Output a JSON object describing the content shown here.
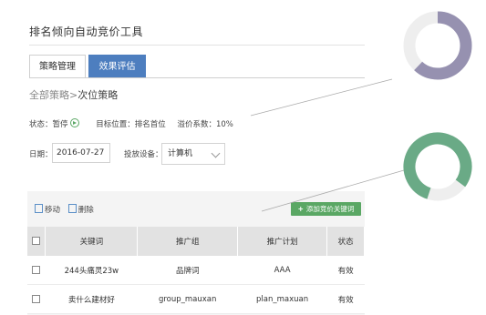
{
  "app": {
    "title": "排名倾向自动竞价工具"
  },
  "tabs": [
    {
      "label": "策略管理",
      "active": true
    },
    {
      "label": "效果评估",
      "active": false
    }
  ],
  "breadcrumb": {
    "root": "全部策略",
    "sep": ">",
    "current": "次位策略"
  },
  "status": {
    "label": "状态：暂停",
    "target": "目标位置：排名首位",
    "premium": "溢价系数：10%"
  },
  "filters": {
    "date_label": "日期：",
    "date_value": "2016-07-27",
    "device_label": "投放设备：",
    "device_value": "计算机"
  },
  "toolbar": {
    "move_label": "移动",
    "delete_label": "删除",
    "add_label": "添加竞价关键词"
  },
  "table": {
    "headers": [
      "关键词",
      "推广组",
      "推广计划",
      "状态"
    ],
    "rows": [
      [
        "244头痛灵23w",
        "品牌词",
        "AAA",
        "有效"
      ],
      [
        "卖什么建材好",
        "group_mauxan",
        "plan_maxuan",
        "有效"
      ]
    ]
  },
  "donuts": [
    {
      "fraction": 0.62,
      "color": "#9691b0"
    },
    {
      "fraction": 0.8,
      "color": "#6aaa86"
    }
  ],
  "colors": {
    "accent": "#4d7ebf",
    "add_button": "#5aa764",
    "track": "#eeeeee"
  }
}
